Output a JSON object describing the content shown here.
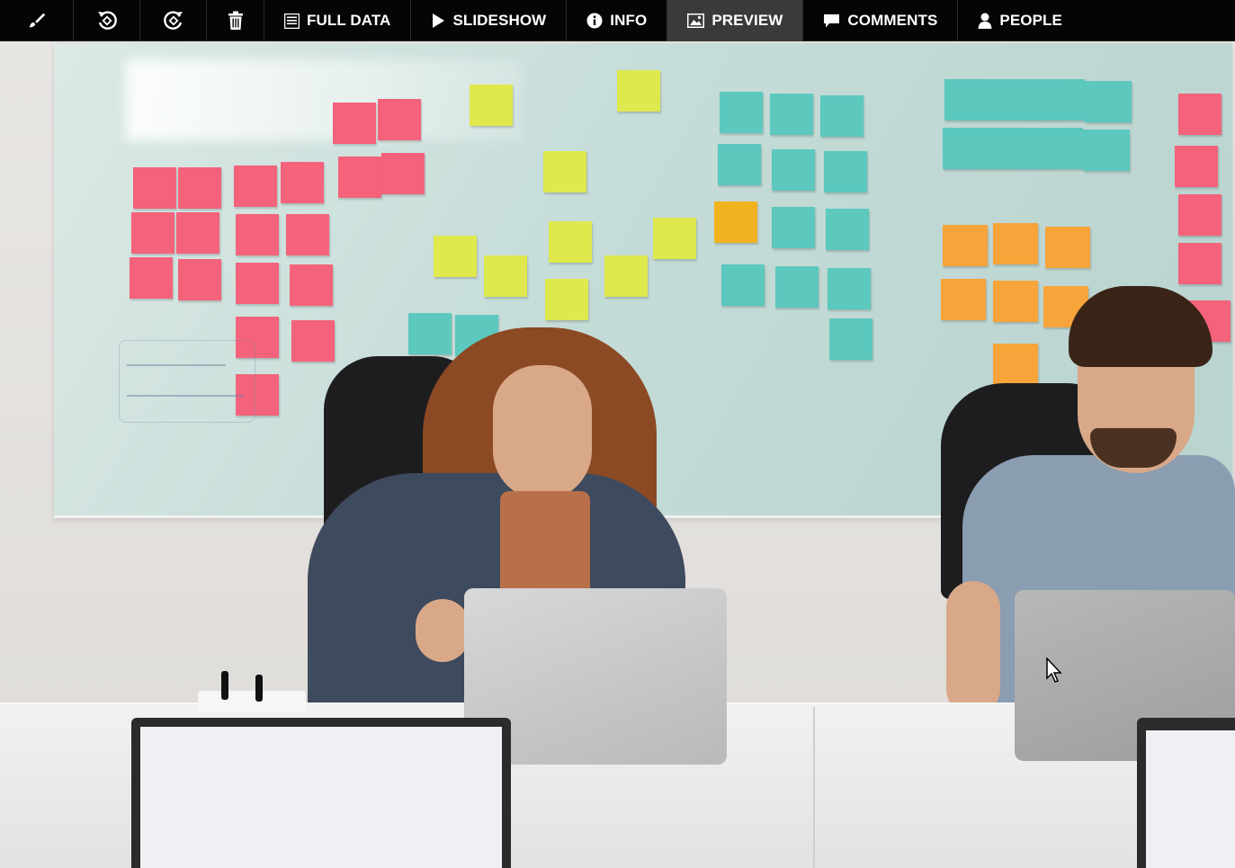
{
  "toolbar": {
    "icon_buttons": {
      "paint": "paintbrush-icon",
      "rotate_left": "rotate-left-icon",
      "rotate_right": "rotate-right-icon",
      "delete": "trash-icon"
    },
    "full_data_label": "FULL DATA",
    "slideshow_label": "SLIDESHOW",
    "info_label": "INFO",
    "preview_label": "PREVIEW",
    "comments_label": "COMMENTS",
    "people_label": "PEOPLE",
    "active_tab": "PREVIEW"
  },
  "preview": {
    "image_subject": "office meeting photo with sticky notes on whiteboard"
  },
  "colors": {
    "toolbar_bg": "#050505",
    "active_tab_bg": "#3a3a3a",
    "note_pink": "#f4637b",
    "note_yellow": "#dfe84d",
    "note_teal": "#5cc8be",
    "note_orange": "#f7a43a"
  }
}
